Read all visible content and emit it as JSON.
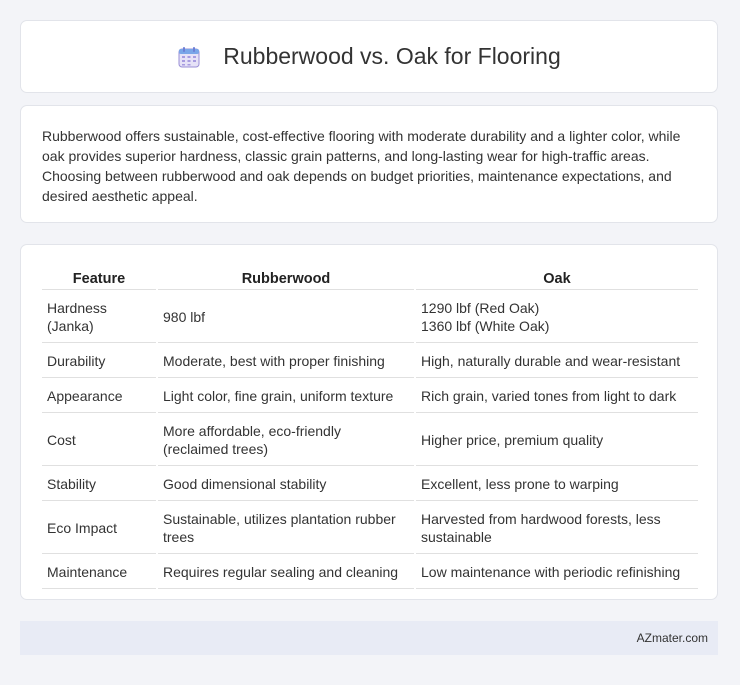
{
  "header": {
    "icon": "calendar-icon",
    "title": "Rubberwood vs. Oak for Flooring"
  },
  "summary": {
    "text": "Rubberwood offers sustainable, cost-effective flooring with moderate durability and a lighter color, while oak provides superior hardness, classic grain patterns, and long-lasting wear for high-traffic areas. Choosing between rubberwood and oak depends on budget priorities, maintenance expectations, and desired aesthetic appeal."
  },
  "table": {
    "headers": [
      "Feature",
      "Rubberwood",
      "Oak"
    ],
    "rows": [
      {
        "feature": "Hardness (Janka)",
        "rubberwood": "980 lbf",
        "oak_line1": "1290 lbf (Red Oak)",
        "oak_line2": "1360 lbf (White Oak)"
      },
      {
        "feature": "Durability",
        "rubberwood": "Moderate, best with proper finishing",
        "oak": "High, naturally durable and wear-resistant"
      },
      {
        "feature": "Appearance",
        "rubberwood": "Light color, fine grain, uniform texture",
        "oak": "Rich grain, varied tones from light to dark"
      },
      {
        "feature": "Cost",
        "rubberwood": "More affordable, eco-friendly (reclaimed trees)",
        "oak": "Higher price, premium quality"
      },
      {
        "feature": "Stability",
        "rubberwood": "Good dimensional stability",
        "oak": "Excellent, less prone to warping"
      },
      {
        "feature": "Eco Impact",
        "rubberwood": "Sustainable, utilizes plantation rubber trees",
        "oak": "Harvested from hardwood forests, less sustainable"
      },
      {
        "feature": "Maintenance",
        "rubberwood": "Requires regular sealing and cleaning",
        "oak": "Low maintenance with periodic refinishing"
      }
    ]
  },
  "footer": {
    "brand": "AZmater.com"
  }
}
